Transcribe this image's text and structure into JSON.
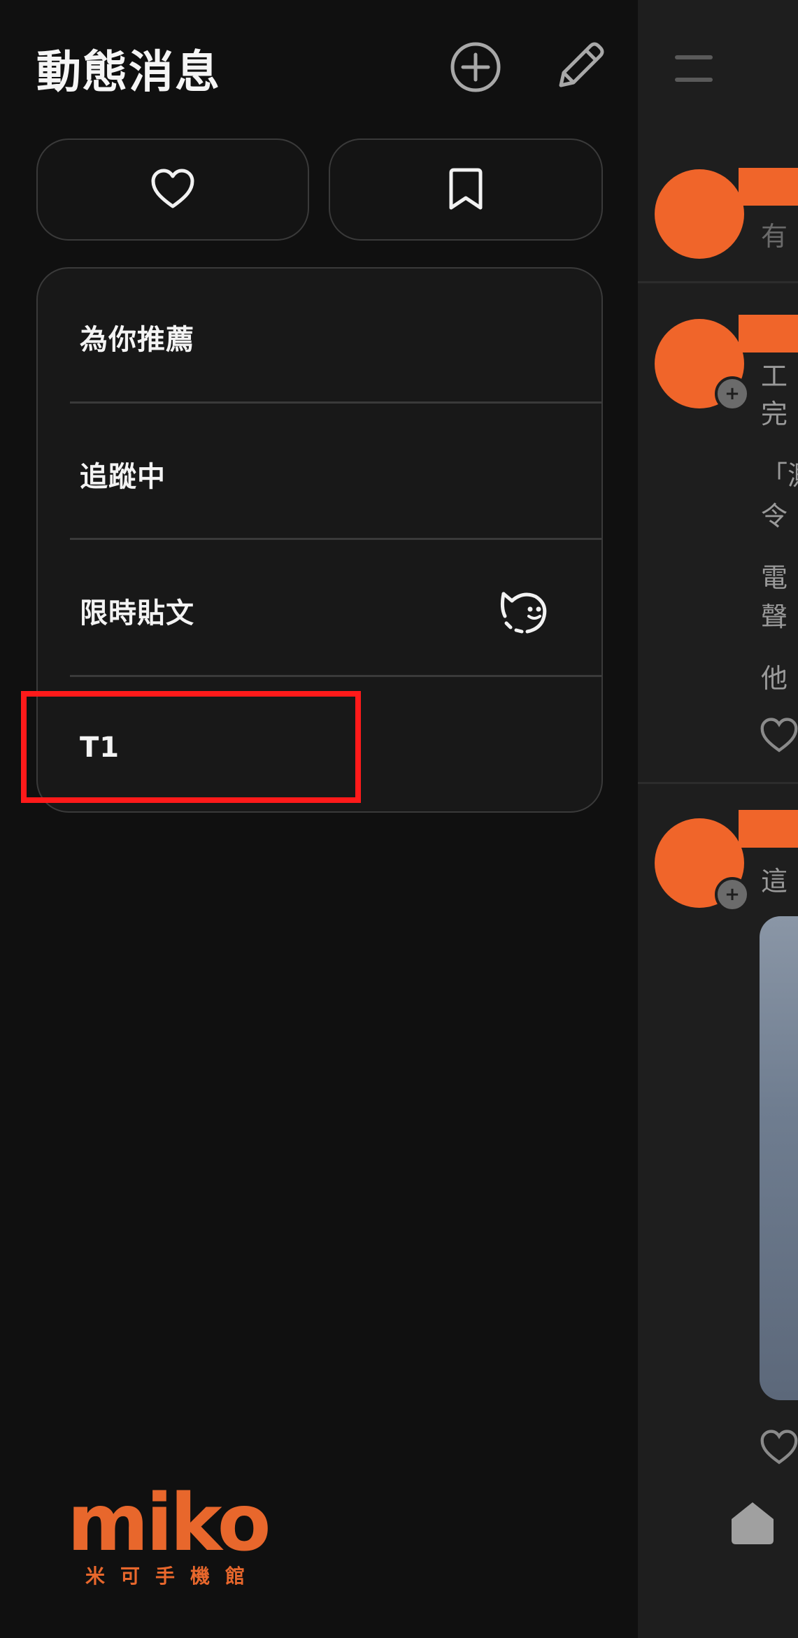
{
  "drawer": {
    "title": "動態消息",
    "actions": [
      {
        "name": "add-feed",
        "icon": "plus-circle-icon"
      },
      {
        "name": "edit-feed",
        "icon": "pencil-icon"
      }
    ],
    "quick_buttons": [
      {
        "name": "likes",
        "icon": "heart-icon"
      },
      {
        "name": "saved",
        "icon": "bookmark-icon"
      }
    ],
    "menu_items": [
      {
        "label": "為你推薦"
      },
      {
        "label": "追蹤中"
      },
      {
        "label": "限時貼文",
        "icon": "ghost-face-icon"
      },
      {
        "label": "T1"
      }
    ],
    "highlighted_item": "T1"
  },
  "feed": {
    "composer_hint": "有",
    "posts": [
      {
        "lines": [
          "工",
          "完"
        ],
        "extra": [
          "「測",
          "令",
          "電",
          "聲",
          "他"
        ]
      },
      {
        "lines": [
          "這"
        ]
      }
    ]
  },
  "watermark": {
    "word": "miko",
    "subtitle": "米可手機館"
  },
  "colors": {
    "background": "#101010",
    "accent": "#f0652a",
    "highlight": "#ff1a1a"
  }
}
